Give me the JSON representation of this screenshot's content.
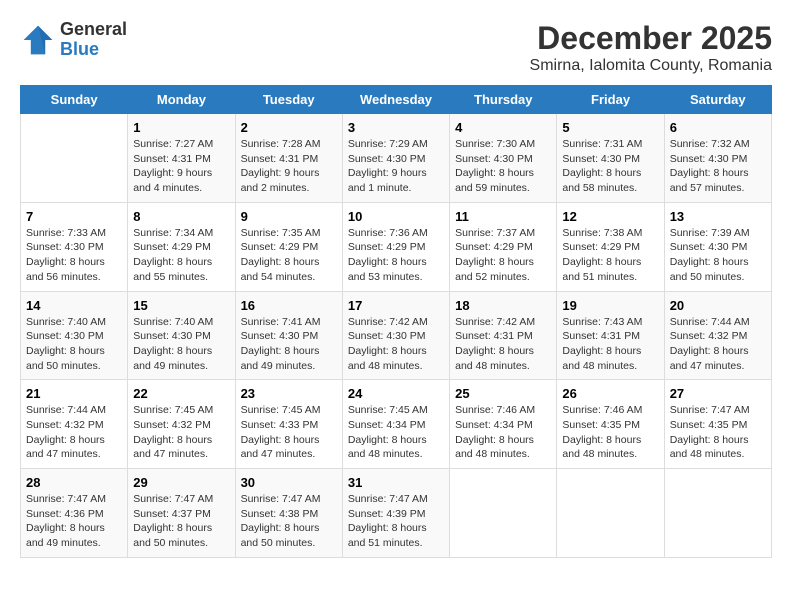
{
  "logo": {
    "general": "General",
    "blue": "Blue"
  },
  "title": "December 2025",
  "subtitle": "Smirna, Ialomita County, Romania",
  "weekdays": [
    "Sunday",
    "Monday",
    "Tuesday",
    "Wednesday",
    "Thursday",
    "Friday",
    "Saturday"
  ],
  "weeks": [
    [
      {
        "day": "",
        "content": ""
      },
      {
        "day": "1",
        "content": "Sunrise: 7:27 AM\nSunset: 4:31 PM\nDaylight: 9 hours\nand 4 minutes."
      },
      {
        "day": "2",
        "content": "Sunrise: 7:28 AM\nSunset: 4:31 PM\nDaylight: 9 hours\nand 2 minutes."
      },
      {
        "day": "3",
        "content": "Sunrise: 7:29 AM\nSunset: 4:30 PM\nDaylight: 9 hours\nand 1 minute."
      },
      {
        "day": "4",
        "content": "Sunrise: 7:30 AM\nSunset: 4:30 PM\nDaylight: 8 hours\nand 59 minutes."
      },
      {
        "day": "5",
        "content": "Sunrise: 7:31 AM\nSunset: 4:30 PM\nDaylight: 8 hours\nand 58 minutes."
      },
      {
        "day": "6",
        "content": "Sunrise: 7:32 AM\nSunset: 4:30 PM\nDaylight: 8 hours\nand 57 minutes."
      }
    ],
    [
      {
        "day": "7",
        "content": "Sunrise: 7:33 AM\nSunset: 4:30 PM\nDaylight: 8 hours\nand 56 minutes."
      },
      {
        "day": "8",
        "content": "Sunrise: 7:34 AM\nSunset: 4:29 PM\nDaylight: 8 hours\nand 55 minutes."
      },
      {
        "day": "9",
        "content": "Sunrise: 7:35 AM\nSunset: 4:29 PM\nDaylight: 8 hours\nand 54 minutes."
      },
      {
        "day": "10",
        "content": "Sunrise: 7:36 AM\nSunset: 4:29 PM\nDaylight: 8 hours\nand 53 minutes."
      },
      {
        "day": "11",
        "content": "Sunrise: 7:37 AM\nSunset: 4:29 PM\nDaylight: 8 hours\nand 52 minutes."
      },
      {
        "day": "12",
        "content": "Sunrise: 7:38 AM\nSunset: 4:29 PM\nDaylight: 8 hours\nand 51 minutes."
      },
      {
        "day": "13",
        "content": "Sunrise: 7:39 AM\nSunset: 4:30 PM\nDaylight: 8 hours\nand 50 minutes."
      }
    ],
    [
      {
        "day": "14",
        "content": "Sunrise: 7:40 AM\nSunset: 4:30 PM\nDaylight: 8 hours\nand 50 minutes."
      },
      {
        "day": "15",
        "content": "Sunrise: 7:40 AM\nSunset: 4:30 PM\nDaylight: 8 hours\nand 49 minutes."
      },
      {
        "day": "16",
        "content": "Sunrise: 7:41 AM\nSunset: 4:30 PM\nDaylight: 8 hours\nand 49 minutes."
      },
      {
        "day": "17",
        "content": "Sunrise: 7:42 AM\nSunset: 4:30 PM\nDaylight: 8 hours\nand 48 minutes."
      },
      {
        "day": "18",
        "content": "Sunrise: 7:42 AM\nSunset: 4:31 PM\nDaylight: 8 hours\nand 48 minutes."
      },
      {
        "day": "19",
        "content": "Sunrise: 7:43 AM\nSunset: 4:31 PM\nDaylight: 8 hours\nand 48 minutes."
      },
      {
        "day": "20",
        "content": "Sunrise: 7:44 AM\nSunset: 4:32 PM\nDaylight: 8 hours\nand 47 minutes."
      }
    ],
    [
      {
        "day": "21",
        "content": "Sunrise: 7:44 AM\nSunset: 4:32 PM\nDaylight: 8 hours\nand 47 minutes."
      },
      {
        "day": "22",
        "content": "Sunrise: 7:45 AM\nSunset: 4:32 PM\nDaylight: 8 hours\nand 47 minutes."
      },
      {
        "day": "23",
        "content": "Sunrise: 7:45 AM\nSunset: 4:33 PM\nDaylight: 8 hours\nand 47 minutes."
      },
      {
        "day": "24",
        "content": "Sunrise: 7:45 AM\nSunset: 4:34 PM\nDaylight: 8 hours\nand 48 minutes."
      },
      {
        "day": "25",
        "content": "Sunrise: 7:46 AM\nSunset: 4:34 PM\nDaylight: 8 hours\nand 48 minutes."
      },
      {
        "day": "26",
        "content": "Sunrise: 7:46 AM\nSunset: 4:35 PM\nDaylight: 8 hours\nand 48 minutes."
      },
      {
        "day": "27",
        "content": "Sunrise: 7:47 AM\nSunset: 4:35 PM\nDaylight: 8 hours\nand 48 minutes."
      }
    ],
    [
      {
        "day": "28",
        "content": "Sunrise: 7:47 AM\nSunset: 4:36 PM\nDaylight: 8 hours\nand 49 minutes."
      },
      {
        "day": "29",
        "content": "Sunrise: 7:47 AM\nSunset: 4:37 PM\nDaylight: 8 hours\nand 50 minutes."
      },
      {
        "day": "30",
        "content": "Sunrise: 7:47 AM\nSunset: 4:38 PM\nDaylight: 8 hours\nand 50 minutes."
      },
      {
        "day": "31",
        "content": "Sunrise: 7:47 AM\nSunset: 4:39 PM\nDaylight: 8 hours\nand 51 minutes."
      },
      {
        "day": "",
        "content": ""
      },
      {
        "day": "",
        "content": ""
      },
      {
        "day": "",
        "content": ""
      }
    ]
  ]
}
